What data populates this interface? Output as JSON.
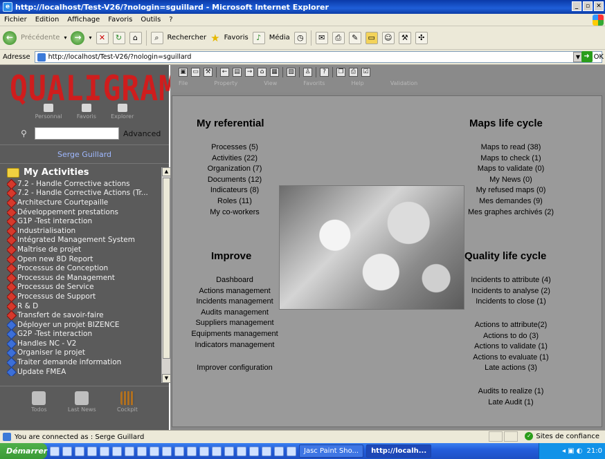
{
  "window": {
    "title": "http://localhost/Test-V26/?nologin=sguillard - Microsoft Internet Explorer"
  },
  "menu": [
    "Fichier",
    "Edition",
    "Affichage",
    "Favoris",
    "Outils",
    "?"
  ],
  "toolbar": {
    "back": "Précédente",
    "search": "Rechercher",
    "favorites": "Favoris",
    "media": "Média"
  },
  "address": {
    "label": "Adresse",
    "url": "http://localhost/Test-V26/?nologin=sguillard",
    "go": "OK"
  },
  "left": {
    "logo": "QUALIGRAM",
    "nav": [
      "Personnal",
      "Favoris",
      "Explorer"
    ],
    "search_label": "Advanced",
    "user": "Serge Guillard",
    "activities_title": "My Activities",
    "activities": [
      {
        "label": "7.2 - Handle Corrective actions",
        "icon": "process"
      },
      {
        "label": "7.2 - Handle Corrective Actions (Tr...",
        "icon": "process"
      },
      {
        "label": "Architecture Courtepaille",
        "icon": "process"
      },
      {
        "label": "Développement prestations",
        "icon": "process"
      },
      {
        "label": "G1P -Test interaction",
        "icon": "process"
      },
      {
        "label": "Industrialisation",
        "icon": "process"
      },
      {
        "label": "Intégrated Management System",
        "icon": "process"
      },
      {
        "label": "Maîtrise de projet",
        "icon": "process"
      },
      {
        "label": "Open new 8D Report",
        "icon": "process"
      },
      {
        "label": "Processus de Conception",
        "icon": "process"
      },
      {
        "label": "Processus de Management",
        "icon": "process"
      },
      {
        "label": "Processus de Service",
        "icon": "process"
      },
      {
        "label": "Processus de Support",
        "icon": "process"
      },
      {
        "label": "R & D",
        "icon": "process"
      },
      {
        "label": "Transfert de savoir-faire",
        "icon": "process"
      },
      {
        "label": "Déployer un projet BIZENCE",
        "icon": "blue"
      },
      {
        "label": "G2P -Test interaction",
        "icon": "blue"
      },
      {
        "label": "Handles NC - V2",
        "icon": "blue"
      },
      {
        "label": "Organiser le projet",
        "icon": "blue"
      },
      {
        "label": "Traiter demande information",
        "icon": "blue"
      },
      {
        "label": "Update FMEA",
        "icon": "blue"
      }
    ],
    "bottom": [
      "Todos",
      "Last News",
      "Cockpit"
    ]
  },
  "appnav": {
    "labels": [
      "File",
      "Property",
      "View",
      "Favorits",
      "Help",
      "Validation"
    ]
  },
  "main": {
    "referential": {
      "title": "My referential",
      "items": [
        "Processes (5)",
        "Activities (22)",
        "Organization (7)",
        "Documents (12)",
        "Indicateurs (8)",
        "Roles (11)",
        "My co-workers"
      ]
    },
    "maps": {
      "title": "Maps life cycle",
      "items": [
        "Maps to read (38)",
        "Maps to check (1)",
        "Maps to validate (0)",
        "My News (0)",
        "My refused maps (0)",
        "Mes demandes (9)",
        "Mes graphes archivés (2)"
      ]
    },
    "improve": {
      "title": "Improve",
      "items": [
        "Dashboard",
        "Actions management",
        "Incidents management",
        "Audits management",
        "Suppliers management",
        "Equipments management",
        "Indicators management"
      ],
      "config": "Improver configuration"
    },
    "quality": {
      "title": "Quality life cycle",
      "incidents": [
        "Incidents to attribute (4)",
        "Incidents to analyse (2)",
        "Incidents to close (1)"
      ],
      "actions": [
        "Actions to attribute(2)",
        "Actions to do (3)",
        "Actions to validate (1)",
        "Actions to evaluate (1)",
        "Late actions (3)"
      ],
      "audits": [
        "Audits to realize (1)",
        "Late Audit (1)"
      ]
    }
  },
  "status": {
    "text": "You are connected as : Serge Guillard",
    "zone": "Sites de confiance"
  },
  "taskbar": {
    "start": "Démarrer",
    "tasks": [
      "Jasc Paint Sho...",
      "http://localh..."
    ],
    "clock": "21:0"
  }
}
